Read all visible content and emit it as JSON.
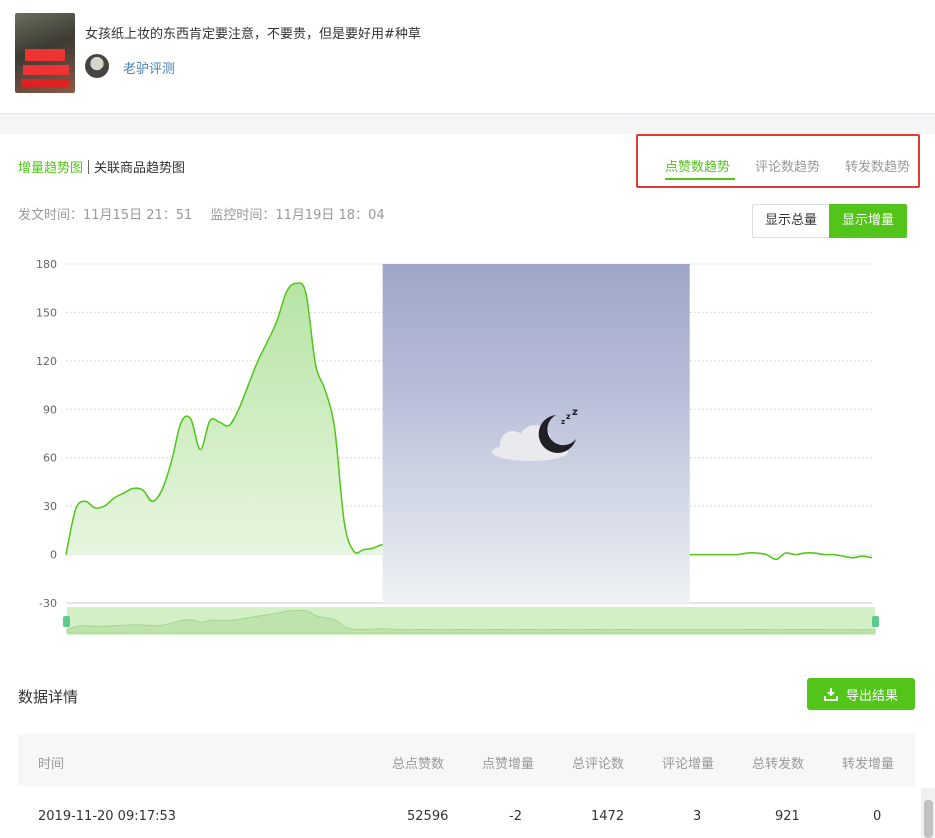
{
  "post": {
    "title": "女孩纸上妆的东西肯定要注意，不要贵，但是要好用#种草",
    "author": "老驴评测"
  },
  "trend_tabs": {
    "increment": "增量趋势图",
    "related": "关联商品趋势图"
  },
  "metric_tabs": [
    {
      "label": "点赞数趋势",
      "active": true
    },
    {
      "label": "评论数趋势",
      "active": false
    },
    {
      "label": "转发数趋势",
      "active": false
    }
  ],
  "times": {
    "publish": "发文时间：11月15日 21：51",
    "monitor": "监控时间：11月19日 18：04"
  },
  "toggle": {
    "total_label": "显示总量",
    "increment_label": "显示增量",
    "selected": "显示增量"
  },
  "colors": {
    "accent": "#52c41a",
    "highlight_border": "#e53935"
  },
  "chart_data": {
    "type": "area",
    "ylim": [
      -30,
      180
    ],
    "yticks": [
      -30,
      0,
      30,
      60,
      90,
      120,
      150,
      180
    ],
    "grid": true,
    "points": [
      [
        0,
        0
      ],
      [
        1,
        28
      ],
      [
        2,
        33
      ],
      [
        3,
        29
      ],
      [
        4,
        30
      ],
      [
        5,
        35
      ],
      [
        6,
        38
      ],
      [
        7,
        41
      ],
      [
        8,
        40
      ],
      [
        9,
        33
      ],
      [
        10,
        40
      ],
      [
        11,
        58
      ],
      [
        12,
        82
      ],
      [
        13,
        84
      ],
      [
        14,
        65
      ],
      [
        15,
        83
      ],
      [
        16,
        82
      ],
      [
        17,
        80
      ],
      [
        18,
        90
      ],
      [
        19,
        105
      ],
      [
        20,
        120
      ],
      [
        21,
        132
      ],
      [
        22,
        145
      ],
      [
        23,
        163
      ],
      [
        24,
        168
      ],
      [
        25,
        162
      ],
      [
        26,
        118
      ],
      [
        27,
        102
      ],
      [
        28,
        78
      ],
      [
        29,
        20
      ],
      [
        30,
        2
      ],
      [
        31,
        3
      ],
      [
        32,
        4
      ],
      [
        33,
        6
      ],
      [
        34,
        3
      ],
      [
        35,
        0
      ],
      [
        36,
        -1
      ],
      [
        37,
        2
      ],
      [
        38,
        0
      ],
      [
        39,
        -1
      ],
      [
        40,
        0
      ],
      [
        41,
        1
      ],
      [
        42,
        0
      ],
      [
        43,
        -1
      ],
      [
        44,
        0
      ],
      [
        45,
        1
      ],
      [
        46,
        0
      ],
      [
        47,
        0
      ],
      [
        48,
        1
      ],
      [
        49,
        0
      ],
      [
        50,
        0
      ],
      [
        51,
        1
      ],
      [
        52,
        0
      ],
      [
        53,
        -1
      ],
      [
        54,
        0
      ],
      [
        55,
        1
      ],
      [
        56,
        0
      ],
      [
        57,
        0
      ],
      [
        58,
        1
      ],
      [
        59,
        0
      ],
      [
        60,
        0
      ],
      [
        61,
        0
      ],
      [
        62,
        0
      ],
      [
        63,
        0
      ],
      [
        64,
        0
      ],
      [
        65,
        0
      ],
      [
        66,
        0
      ],
      [
        67,
        0
      ],
      [
        68,
        0
      ],
      [
        69,
        0
      ],
      [
        70,
        0
      ],
      [
        71,
        1
      ],
      [
        72,
        1
      ],
      [
        73,
        0
      ],
      [
        74,
        -3
      ],
      [
        75,
        1
      ],
      [
        76,
        0
      ],
      [
        77,
        1
      ],
      [
        78,
        1
      ],
      [
        79,
        0
      ],
      [
        80,
        0
      ],
      [
        81,
        -1
      ],
      [
        82,
        -2
      ],
      [
        83,
        -1
      ],
      [
        84,
        -2
      ]
    ],
    "overlay_start": 33,
    "overlay_end": 65,
    "xmax": 84
  },
  "details": {
    "title": "数据详情",
    "export_label": "导出结果",
    "columns": [
      "时间",
      "总点赞数",
      "点赞增量",
      "总评论数",
      "评论增量",
      "总转发数",
      "转发增量"
    ],
    "rows": [
      [
        "2019-11-20 09:17:53",
        "52596",
        "-2",
        "1472",
        "3",
        "921",
        "0"
      ]
    ]
  }
}
